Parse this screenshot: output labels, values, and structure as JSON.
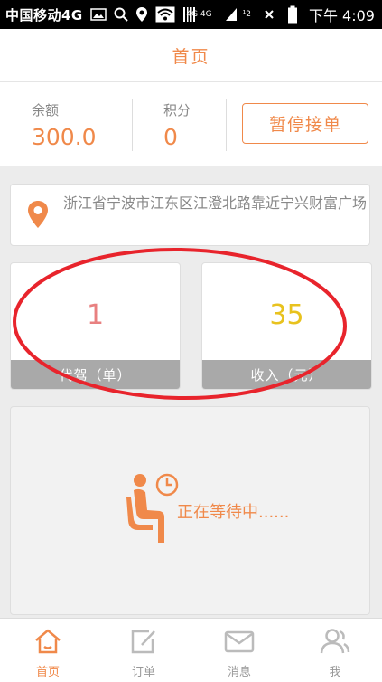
{
  "status_bar": {
    "carrier": "中国移动4G",
    "network_small": "4G 4G",
    "sim_small": "¹2",
    "time": "下午 4:09"
  },
  "header": {
    "title": "首页"
  },
  "stats": {
    "balance_label": "余额",
    "balance_value": "300.0",
    "points_label": "积分",
    "points_value": "0",
    "pause_button": "暂停接单"
  },
  "location": {
    "address": "浙江省宁波市江东区江澄北路靠近宁兴财富广场"
  },
  "cards": [
    {
      "value": "1",
      "label": "代驾（单）",
      "value_color": "#e88080"
    },
    {
      "value": "35",
      "label": "收入（元）",
      "value_color": "#e8c21e"
    }
  ],
  "waiting": {
    "text": "正在等待中......"
  },
  "tabs": [
    {
      "label": "首页",
      "icon": "home-icon",
      "active": true
    },
    {
      "label": "订单",
      "icon": "edit-icon",
      "active": false
    },
    {
      "label": "消息",
      "icon": "mail-icon",
      "active": false
    },
    {
      "label": "我",
      "icon": "user-icon",
      "active": false
    }
  ],
  "colors": {
    "accent": "#f0894a",
    "overlay_circle": "#e8242c"
  }
}
